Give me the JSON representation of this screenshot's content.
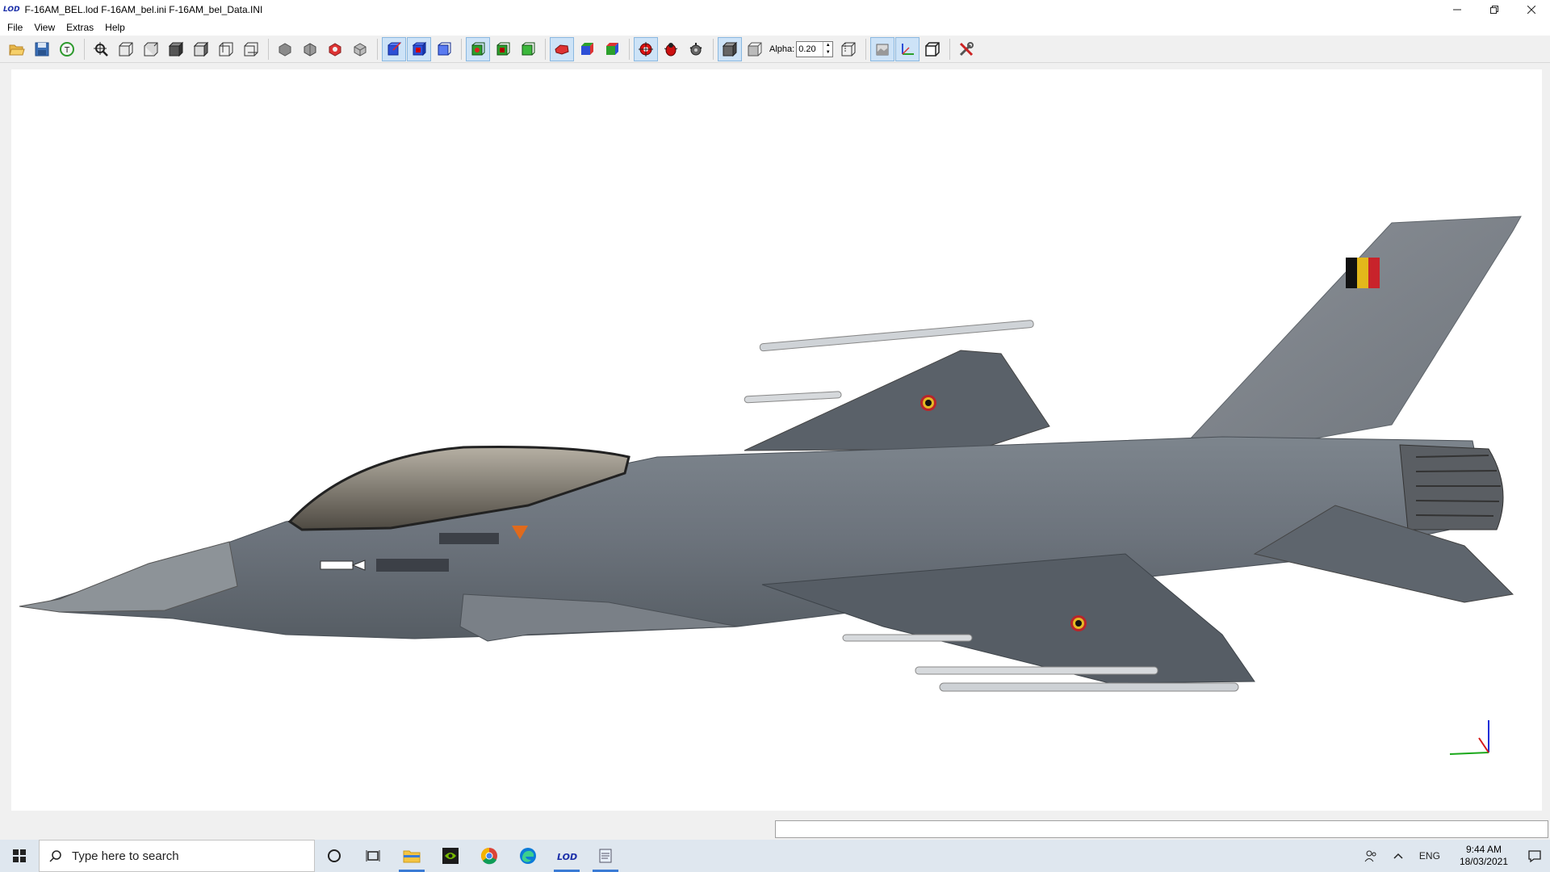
{
  "window": {
    "logo_text": "LOD",
    "title": "F-16AM_BEL.lod  F-16AM_bel.ini  F-16AM_bel_Data.INI"
  },
  "menu": [
    "File",
    "View",
    "Extras",
    "Help"
  ],
  "toolbar": {
    "alpha_label": "Alpha:",
    "alpha_value": "0.20"
  },
  "taskbar": {
    "search_placeholder": "Type here to search",
    "language": "ENG",
    "time": "9:44 AM",
    "date": "18/03/2021"
  },
  "colors": {
    "accent": "#3a7bd5",
    "jet_body": "#6c737c",
    "jet_dark": "#50575f"
  }
}
